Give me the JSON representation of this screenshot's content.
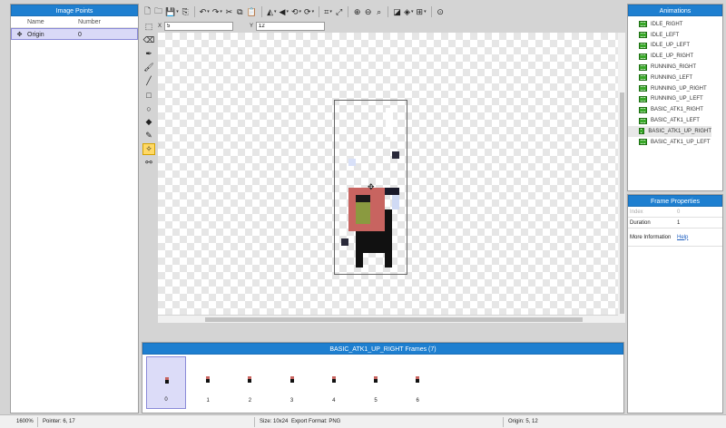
{
  "image_points": {
    "title": "Image Points",
    "col_name": "Name",
    "col_number": "Number",
    "rows": [
      {
        "icon": "crosshair-icon",
        "name": "Origin",
        "number": "0"
      }
    ]
  },
  "toolbar": {
    "icons": [
      "new-file-icon",
      "open-folder-icon",
      "save-icon",
      "export-icon",
      "undo-icon",
      "redo-icon",
      "cut-icon",
      "copy-icon",
      "paste-icon",
      "flip-icon",
      "mirror-icon",
      "rotate-left-icon",
      "rotate-right-icon",
      "crop-icon",
      "resize-icon",
      "zoom-in-icon",
      "zoom-out-icon",
      "zoom-fit-icon",
      "grid-view-icon",
      "layers-icon",
      "grid-icon",
      "target-icon"
    ]
  },
  "tools": [
    "select-tool-icon",
    "eraser-tool-icon",
    "pen-tool-icon",
    "brush-tool-icon",
    "line-tool-icon",
    "rectangle-tool-icon",
    "ellipse-tool-icon",
    "fill-tool-icon",
    "eyedropper-tool-icon",
    "point-tool-icon",
    "bone-tool-icon"
  ],
  "coords": {
    "x_label": "X",
    "x_value": "5",
    "y_label": "Y",
    "y_value": "12"
  },
  "frames": {
    "title": "BASIC_ATK1_UP_RIGHT Frames (7)",
    "items": [
      "0",
      "1",
      "2",
      "3",
      "4",
      "5",
      "6"
    ],
    "selected_index": 0
  },
  "animations": {
    "title": "Animations",
    "items": [
      "IDLE_RIGHT",
      "IDLE_LEFT",
      "IDLE_UP_LEFT",
      "IDLE_UP_RIGHT",
      "RUNNING_RIGHT",
      "RUNNING_LEFT",
      "RUNNING_UP_RIGHT",
      "RUNNING_UP_LEFT",
      "BASIC_ATK1_RIGHT",
      "BASIC_ATK1_LEFT",
      "BASIC_ATK1_UP_RIGHT",
      "BASIC_ATK1_UP_LEFT"
    ],
    "selected": "BASIC_ATK1_UP_RIGHT"
  },
  "frame_properties": {
    "title": "Frame Properties",
    "index_label": "Index",
    "index_value": "0",
    "duration_label": "Duration",
    "duration_value": "1",
    "info_label": "More Information",
    "info_link": "Help"
  },
  "status": {
    "zoom": "1600%",
    "pointer": "Pointer: 6, 17",
    "size": "Size: 10x24",
    "export": "Export Format: PNG",
    "origin": "Origin: 5, 12"
  },
  "colors": {
    "accent": "#1e7fd0",
    "selection": "#d9d9f7",
    "active_tool": "#ffd966"
  }
}
